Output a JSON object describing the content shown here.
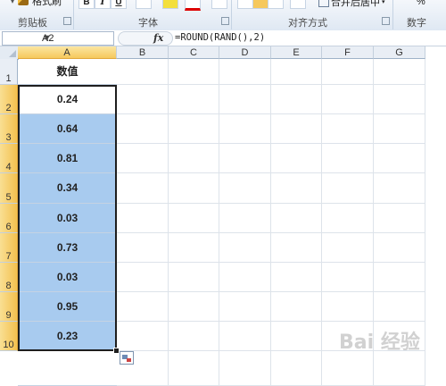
{
  "ribbon": {
    "format_painter": "格式刷",
    "bold": "B",
    "italic": "I",
    "underline": "U",
    "merge_center": "合并后居中",
    "percent": "%",
    "groups": {
      "clipboard": "剪贴板",
      "font": "字体",
      "alignment": "对齐方式",
      "number": "数字"
    }
  },
  "formula_bar": {
    "name_box": "A2",
    "fx": "fx",
    "formula": "=ROUND(RAND(),2)"
  },
  "columns": [
    "A",
    "B",
    "C",
    "D",
    "E",
    "F",
    "G"
  ],
  "rows": [
    "1",
    "2",
    "3",
    "4",
    "5",
    "6",
    "7",
    "8",
    "9",
    "10"
  ],
  "sheet": {
    "header": "数值",
    "values": [
      "0.24",
      "0.64",
      "0.81",
      "0.34",
      "0.03",
      "0.73",
      "0.03",
      "0.95",
      "0.23"
    ]
  },
  "watermark": "Bai 经验",
  "colors": {
    "selection_fill": "#a8cbef",
    "header_highlight": "#f6c85c"
  }
}
